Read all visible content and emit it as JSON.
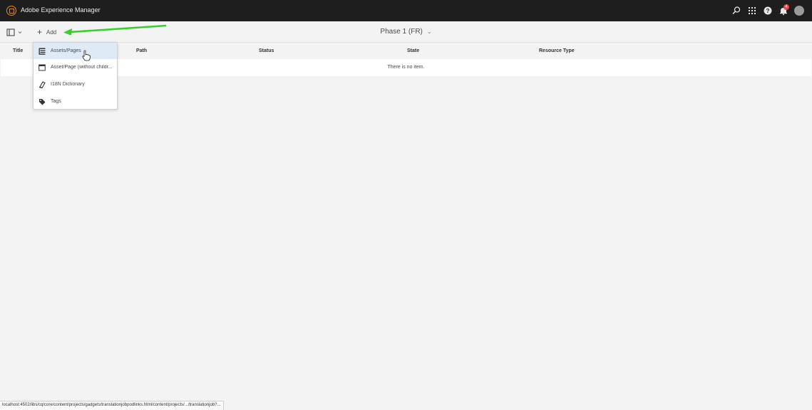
{
  "shell": {
    "app_title": "Adobe Experience Manager",
    "notification_count": "4",
    "icons": [
      "aem-logo-icon",
      "search-icon",
      "apps-grid-icon",
      "help-icon",
      "bell-icon",
      "avatar-icon"
    ],
    "logo_color": "#e68619"
  },
  "actionbar": {
    "add_label": "Add",
    "title": "Phase 1 (FR)"
  },
  "table": {
    "columns": [
      "Title",
      "Path",
      "Status",
      "State",
      "Resource Type"
    ],
    "empty_message": "There is no item."
  },
  "add_menu": {
    "items": [
      {
        "label": "Assets/Pages",
        "icon": "tree-list-icon",
        "selected": true
      },
      {
        "label": "Asset/Page (without childr...",
        "icon": "page-icon",
        "selected": false
      },
      {
        "label": "I18N Dictionary",
        "icon": "dictionary-icon",
        "selected": false
      },
      {
        "label": "Tags",
        "icon": "tags-icon",
        "selected": false
      }
    ]
  },
  "annotation": {
    "arrow_color": "#35d12a"
  },
  "status_bar": {
    "url": "localhost:4502/libs/cq/core/content/projects/gadgets/translationjobpodlinks.html/content/projects/.../translationjob?..."
  }
}
